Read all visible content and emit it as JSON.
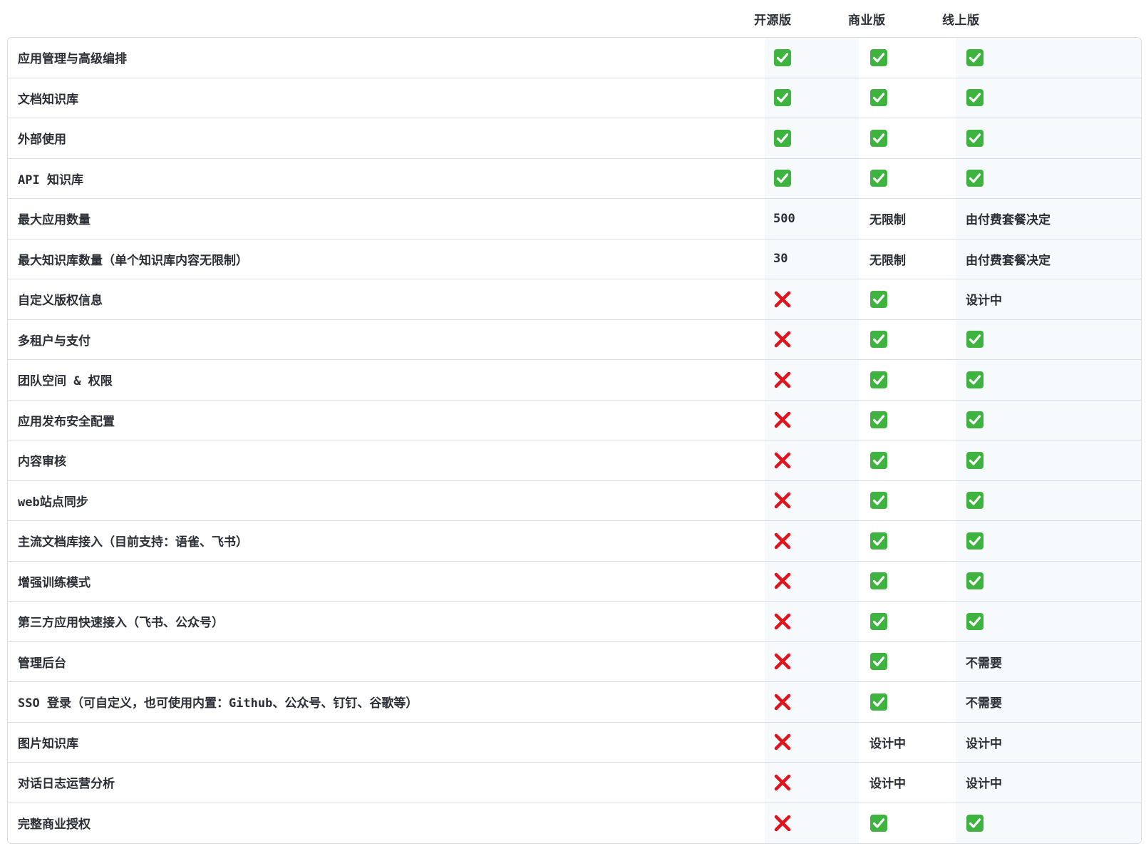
{
  "columns": [
    "开源版",
    "商业版",
    "线上版"
  ],
  "colors": {
    "check_green": "#3fb340",
    "cross_red": "#e0141c",
    "border": "#d9dde3",
    "column_shade": "#f6fafd"
  },
  "rows": [
    {
      "feature": "应用管理与高级编排",
      "values": [
        "check",
        "check",
        "check"
      ]
    },
    {
      "feature": "文档知识库",
      "values": [
        "check",
        "check",
        "check"
      ]
    },
    {
      "feature": "外部使用",
      "values": [
        "check",
        "check",
        "check"
      ]
    },
    {
      "feature": "API 知识库",
      "values": [
        "check",
        "check",
        "check"
      ]
    },
    {
      "feature": "最大应用数量",
      "values": [
        "500",
        "无限制",
        "由付费套餐决定"
      ]
    },
    {
      "feature": "最大知识库数量（单个知识库内容无限制）",
      "values": [
        "30",
        "无限制",
        "由付费套餐决定"
      ]
    },
    {
      "feature": "自定义版权信息",
      "values": [
        "cross",
        "check",
        "设计中"
      ]
    },
    {
      "feature": "多租户与支付",
      "values": [
        "cross",
        "check",
        "check"
      ]
    },
    {
      "feature": "团队空间 & 权限",
      "values": [
        "cross",
        "check",
        "check"
      ]
    },
    {
      "feature": "应用发布安全配置",
      "values": [
        "cross",
        "check",
        "check"
      ]
    },
    {
      "feature": "内容审核",
      "values": [
        "cross",
        "check",
        "check"
      ]
    },
    {
      "feature": "web站点同步",
      "values": [
        "cross",
        "check",
        "check"
      ]
    },
    {
      "feature": "主流文档库接入（目前支持：语雀、飞书）",
      "values": [
        "cross",
        "check",
        "check"
      ]
    },
    {
      "feature": "增强训练模式",
      "values": [
        "cross",
        "check",
        "check"
      ]
    },
    {
      "feature": "第三方应用快速接入（飞书、公众号）",
      "values": [
        "cross",
        "check",
        "check"
      ]
    },
    {
      "feature": "管理后台",
      "values": [
        "cross",
        "check",
        "不需要"
      ]
    },
    {
      "feature": "SSO 登录（可自定义，也可使用内置：Github、公众号、钉钉、谷歌等）",
      "values": [
        "cross",
        "check",
        "不需要"
      ]
    },
    {
      "feature": "图片知识库",
      "values": [
        "cross",
        "设计中",
        "设计中"
      ]
    },
    {
      "feature": "对话日志运营分析",
      "values": [
        "cross",
        "设计中",
        "设计中"
      ]
    },
    {
      "feature": "完整商业授权",
      "values": [
        "cross",
        "check",
        "check"
      ]
    }
  ]
}
